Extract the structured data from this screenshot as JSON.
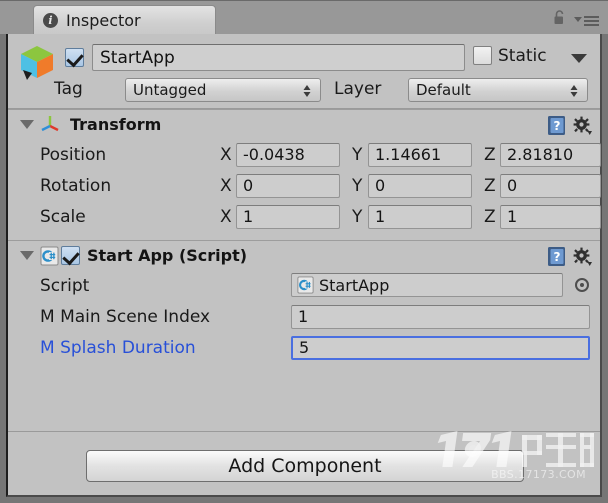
{
  "window": {
    "tab_label": "Inspector",
    "tab_icon": "info-circle-icon",
    "lock_icon": "lock-open-icon",
    "menu_icon": "hamburger-menu-icon"
  },
  "object_header": {
    "prefab_icon": "prefab-cube-icon",
    "enabled_checkbox": "checked",
    "name": "StartApp",
    "static_label": "Static",
    "static_checked": "unchecked",
    "static_dropdown_icon": "chevron-down-icon",
    "tag_label": "Tag",
    "tag_value": "Untagged",
    "layer_label": "Layer",
    "layer_value": "Default"
  },
  "transform": {
    "title": "Transform",
    "icon": "transform-gizmo-icon",
    "help_icon": "help-book-icon",
    "gear_icon": "gear-icon",
    "foldout_icon": "foldout-expanded-icon",
    "rows": [
      {
        "label": "Position",
        "x": "-0.0438",
        "y": "1.14661",
        "z": "2.81810"
      },
      {
        "label": "Rotation",
        "x": "0",
        "y": "0",
        "z": "0"
      },
      {
        "label": "Scale",
        "x": "1",
        "y": "1",
        "z": "1"
      }
    ],
    "axis_x": "X",
    "axis_y": "Y",
    "axis_z": "Z"
  },
  "start_app": {
    "title": "Start App (Script)",
    "script_icon": "csharp-script-icon",
    "enabled_checkbox": "checked",
    "help_icon": "help-book-icon",
    "gear_icon": "gear-icon",
    "foldout_icon": "foldout-expanded-icon",
    "script_row_label": "Script",
    "script_row_value": "StartApp",
    "object_picker_icon": "object-picker-icon",
    "main_scene_index_label": "M Main Scene Index",
    "main_scene_index_value": "1",
    "splash_duration_label": "M Splash Duration",
    "splash_duration_value": "5"
  },
  "footer": {
    "add_component_label": "Add Component"
  },
  "watermark": {
    "site": "BBS.17173.COM"
  },
  "colors": {
    "panel_bg": "#c2c2c2",
    "chrome_bg": "#989898",
    "field_bg": "#cdcdcd",
    "focus_border": "#4a6fe0",
    "modified_label": "#2850d8"
  }
}
